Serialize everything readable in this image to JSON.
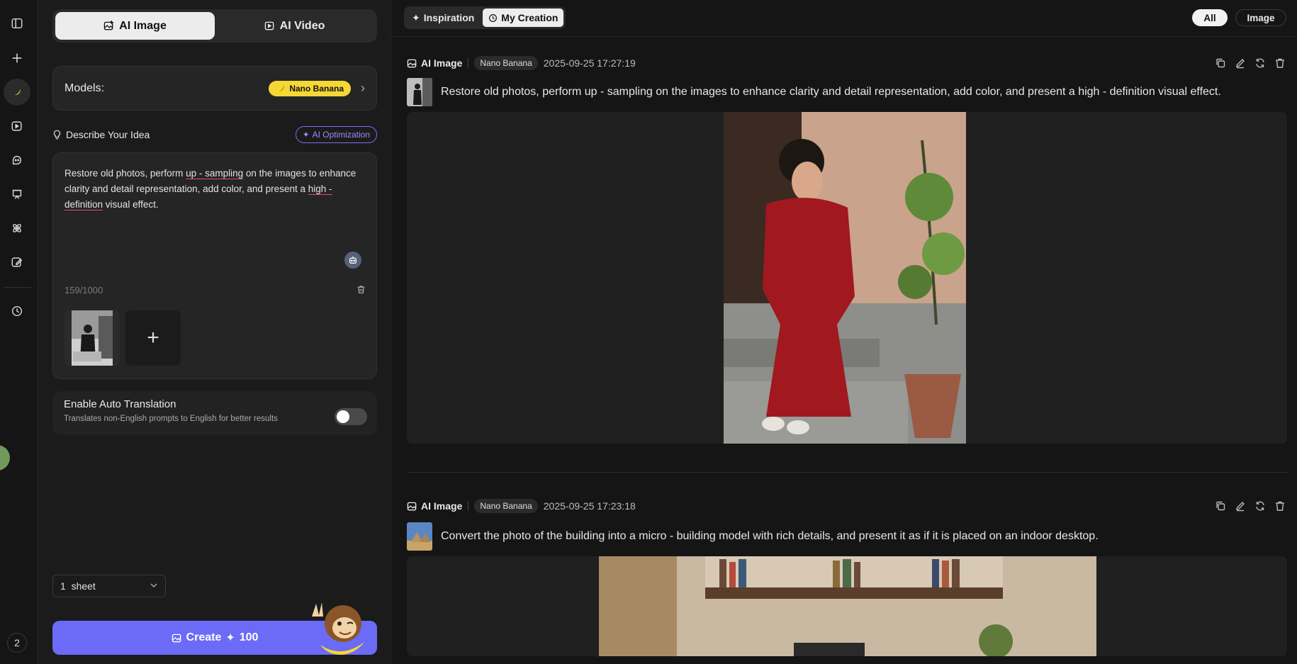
{
  "rail": {
    "badge": "2"
  },
  "panel": {
    "tabs": [
      {
        "label": "AI Image",
        "icon": "image-icon"
      },
      {
        "label": "AI Video",
        "icon": "video-icon"
      }
    ],
    "models_label": "Models:",
    "model_name": "Nano Banana",
    "idea_label": "Describe Your Idea",
    "ai_optimization": "AI Optimization",
    "prompt_parts": [
      "Restore old photos, perform ",
      "up - sampling",
      " on the images to enhance clarity and detail representation, add color, and present a ",
      "high - definition",
      " visual effect."
    ],
    "counter": "159/1000",
    "translation_title": "Enable Auto Translation",
    "translation_sub": "Translates non-English prompts to English for better results",
    "sheet_value": "1  sheet",
    "create_label": "Create",
    "create_cost": "100"
  },
  "main": {
    "view_tabs": [
      {
        "label": "Inspiration",
        "icon": "sparkle-icon"
      },
      {
        "label": "My Creation",
        "icon": "clock-icon"
      }
    ],
    "filters": [
      "All",
      "Image"
    ],
    "cards": [
      {
        "type": "AI Image",
        "model": "Nano Banana",
        "date": "2025-09-25 17:27:19",
        "prompt": "Restore old photos, perform up - sampling on the images to enhance clarity and detail representation, add color, and present a high - definition visual effect."
      },
      {
        "type": "AI Image",
        "model": "Nano Banana",
        "date": "2025-09-25 17:23:18",
        "prompt": "Convert the photo of the building into a micro - building model with rich details, and present it as if it is placed on an indoor desktop."
      }
    ]
  },
  "colors": {
    "accent": "#6b6bf7",
    "model_pill": "#f5d735",
    "ai_opt": "#9a8cff",
    "underline": "#e34b6b"
  }
}
